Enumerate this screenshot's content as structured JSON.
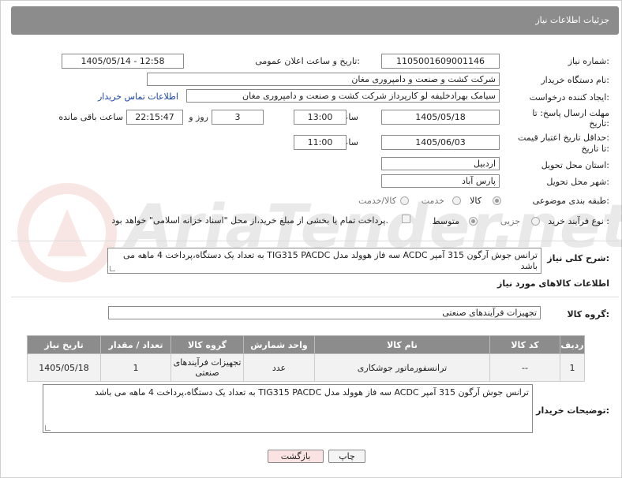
{
  "header": {
    "title": "جزئیات اطلاعات نیاز"
  },
  "fields": {
    "need_number": {
      "label": "شماره نیاز:",
      "value": "1105001609001146"
    },
    "announce_datetime": {
      "label": "تاریخ و ساعت اعلان عمومی:",
      "value": "1405/05/14 - 12:58"
    },
    "buyer_org": {
      "label": "نام دستگاه خریدار:",
      "value": "شرکت کشت و صنعت و دامپروری مغان"
    },
    "requester": {
      "label": "ایجاد کننده درخواست:",
      "value": "سیامک بهرادخلیفه لو کارپرداز شرکت کشت و صنعت و دامپروری مغان",
      "contact_link": "اطلاعات تماس خریدار"
    },
    "reply_deadline": {
      "label_line1": "مهلت ارسال پاسخ: تا",
      "label_line2": "تاریخ:",
      "date": "1405/05/18",
      "time_label": "ساعت",
      "time": "13:00",
      "days": "3",
      "days_label": "روز و",
      "remaining": "22:15:47",
      "remaining_label": "ساعت باقی مانده"
    },
    "price_validity": {
      "label_line1": "حداقل تاریخ اعتبار قیمت:",
      "label_line2": "تا تاریخ:",
      "date": "1405/06/03",
      "time_label": "ساعت",
      "time": "11:00"
    },
    "delivery_province": {
      "label": "استان محل تحویل:",
      "value": "اردبیل"
    },
    "delivery_city": {
      "label": "شهر محل تحویل:",
      "value": "پارس آباد"
    },
    "category": {
      "label": "طبقه بندی موضوعی:",
      "options": [
        "کالا",
        "خدمت",
        "کالا/خدمت"
      ],
      "selected": "کالا"
    },
    "process_type": {
      "label": "نوع فرآیند خرید :",
      "options": [
        "جزیی",
        "متوسط"
      ],
      "selected": "جزیی",
      "payment_note": "پرداخت تمام یا بخشی از مبلغ خرید،از محل \"اسناد خزانه اسلامی\" خواهد بود."
    }
  },
  "description": {
    "label": "شرح کلی نیاز:",
    "value": "ترانس جوش آرگون 315 آمپر ACDC سه فاز هوولد مدل TIG315 PACDC به تعداد یک دستگاه،پرداخت 4 ماهه می باشد"
  },
  "goods_section": {
    "title": "اطلاعات کالاهای مورد نیاز",
    "group_label": "گروه کالا:",
    "group_value": "تجهیزات فرآیندهای صنعتی"
  },
  "table": {
    "headers": [
      "ردیف",
      "کد کالا",
      "نام کالا",
      "واحد شمارش",
      "گروه کالا",
      "تعداد / مقدار",
      "تاریخ نیاز"
    ],
    "rows": [
      [
        "1",
        "--",
        "ترانسفورماتور جوشکاری",
        "عدد",
        "تجهیزات فرآیندهای صنعتی",
        "1",
        "1405/05/18"
      ]
    ]
  },
  "buyer_notes": {
    "label": "توضیحات خریدار:",
    "value": "ترانس جوش آرگون 315 آمپر ACDC سه فاز هوولد مدل TIG315 PACDC به تعداد یک دستگاه،پرداخت 4 ماهه می باشد"
  },
  "buttons": {
    "print": "چاپ",
    "back": "بازگشت"
  },
  "watermark": {
    "text": "AriaTender.net"
  },
  "colors": {
    "header_bg": "#8c8c8c",
    "link": "#1a44a8",
    "back_button_bg": "#fbe3e3",
    "watermark": "#c0392b"
  }
}
